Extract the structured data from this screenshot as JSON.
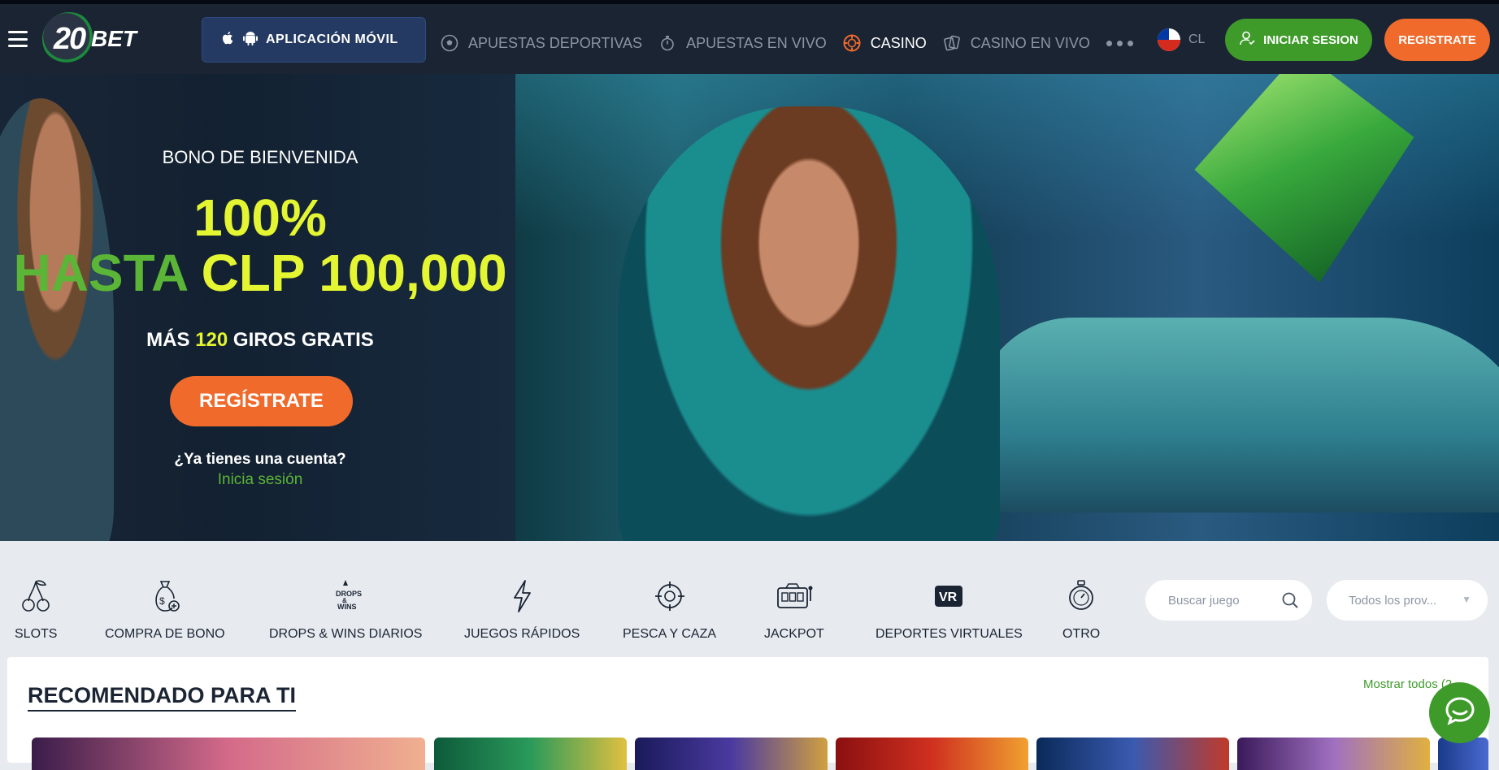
{
  "header": {
    "logo_text": "20BET",
    "logo_number": "20",
    "logo_word": "BET",
    "app_button_label": "APLICACIÓN MÓVIL",
    "nav": [
      {
        "label": "APUESTAS DEPORTIVAS",
        "icon": "soccer-ball-icon",
        "active": false
      },
      {
        "label": "APUESTAS EN VIVO",
        "icon": "live-stopwatch-icon",
        "active": false
      },
      {
        "label": "CASINO",
        "icon": "casino-chip-icon",
        "active": true
      },
      {
        "label": "CASINO EN VIVO",
        "icon": "cards-icon",
        "active": false
      }
    ],
    "lang_code": "CL",
    "login_label": "INICIAR SESION",
    "register_label": "REGISTRATE"
  },
  "hero": {
    "subtitle": "BONO DE BIENVENIDA",
    "percent": "100%",
    "amount_prefix": "HASTA",
    "amount_value": "CLP 100,000",
    "spins_prefix": "MÁS",
    "spins_count": "120",
    "spins_suffix": "GIROS GRATIS",
    "cta_label": "REGÍSTRATE",
    "account_question": "¿Ya tienes una cuenta?",
    "login_link": "Inicia sesión"
  },
  "categories": [
    {
      "label": "SLOTS",
      "icon": "cherries-icon"
    },
    {
      "label": "COMPRA DE BONO",
      "icon": "money-bag-icon"
    },
    {
      "label": "DROPS & WINS DIARIOS",
      "icon": "drops-wins-icon"
    },
    {
      "label": "JUEGOS RÁPIDOS",
      "icon": "lightning-icon"
    },
    {
      "label": "PESCA Y CAZA",
      "icon": "crosshair-icon"
    },
    {
      "label": "JACKPOT",
      "icon": "slot-machine-icon"
    },
    {
      "label": "DEPORTES VIRTUALES",
      "icon": "vr-icon"
    },
    {
      "label": "OTRO",
      "icon": "stopwatch-icon"
    }
  ],
  "search": {
    "placeholder": "Buscar juego"
  },
  "provider_select": {
    "value": "Todos los prov..."
  },
  "recommended": {
    "title": "RECOMENDADO PARA TI",
    "show_all": "Mostrar todos (2"
  },
  "colors": {
    "accent_orange": "#ef6a2b",
    "accent_green": "#3e9b2a",
    "header_bg": "#1b2433",
    "yellow": "#e4f531"
  }
}
